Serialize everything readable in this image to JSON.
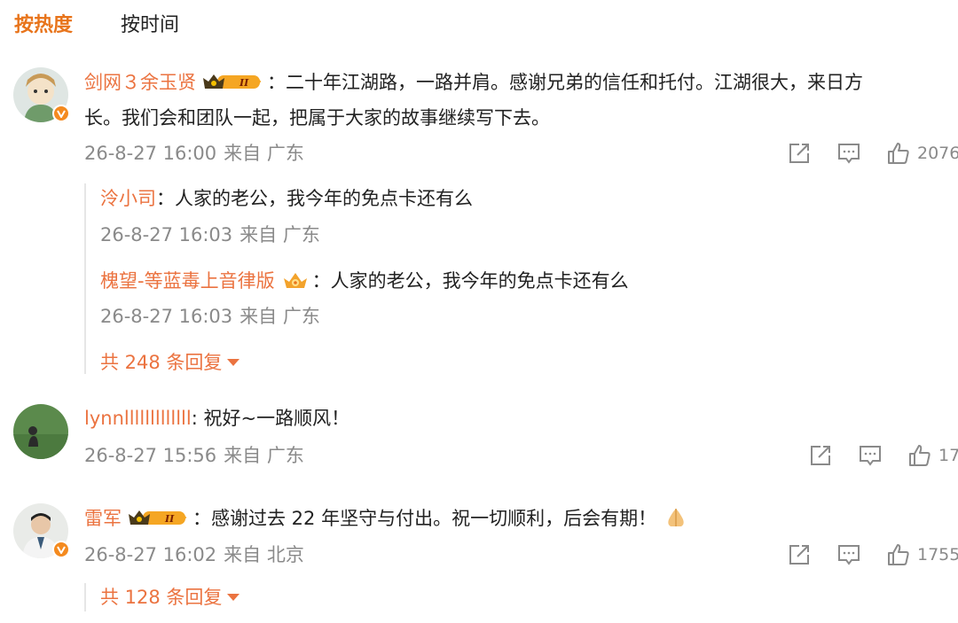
{
  "tabs": {
    "hot": "按热度",
    "time": "按时间"
  },
  "comments": [
    {
      "user": "剑网３余玉贤",
      "text_line1": "：二十年江湖路，一路并肩。感谢兄弟的信任和托付。江湖很大，来日方",
      "text_line2": "长。我们会和团队一起，把属于大家的故事继续写下去。",
      "time": "26-8-27 16:00",
      "from": "来自 广东",
      "likes": "2076",
      "replies": [
        {
          "user": "泠小司",
          "text": "：人家的老公，我今年的免点卡还有么",
          "time": "26-8-27 16:03",
          "from": "来自 广东"
        },
        {
          "user": "槐望-等蓝毒上音律版",
          "text": "：人家的老公，我今年的免点卡还有么",
          "time": "26-8-27 16:03",
          "from": "来自 广东"
        }
      ],
      "more_replies": "共 248 条回复"
    },
    {
      "user": "lynnlllllllllllll",
      "text": ": 祝好~一路顺风！",
      "time": "26-8-27 15:56",
      "from": "来自 广东",
      "likes": "17"
    },
    {
      "user": "雷军",
      "text": "：感谢过去 22 年坚守与付出。祝一切顺利，后会有期！",
      "time": "26-8-27 16:02",
      "from": "来自 北京",
      "likes": "1755",
      "more_replies": "共 128 条回复"
    }
  ],
  "colors": {
    "accent": "#e8741b",
    "username": "#eb7340",
    "meta": "#8a8a8a"
  }
}
